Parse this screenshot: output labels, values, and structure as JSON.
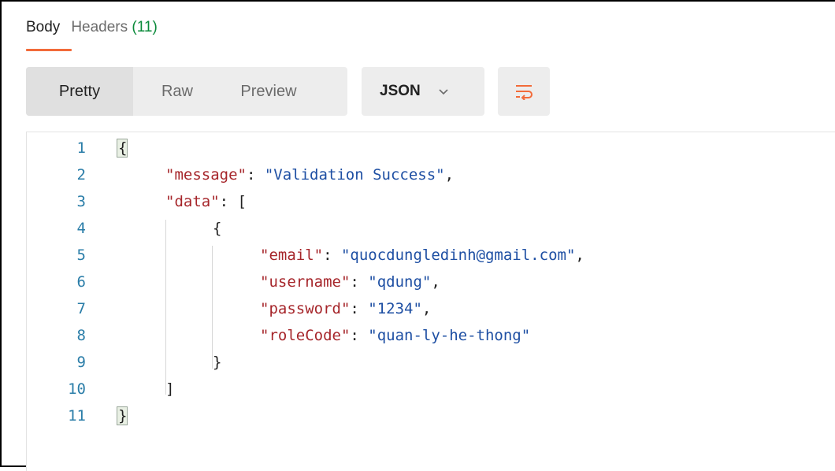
{
  "tabs": {
    "body_label": "Body",
    "headers_label": "Headers",
    "headers_count": "(11)"
  },
  "toolbar": {
    "view_modes": [
      "Pretty",
      "Raw",
      "Preview"
    ],
    "selected_view": "Pretty",
    "format_label": "JSON",
    "wrap_icon": "wrap-lines-icon"
  },
  "colors": {
    "accent": "#f26b3a",
    "line_number": "#2a7da8",
    "json_key": "#a6262b",
    "json_string": "#1e4fa3",
    "headers_count": "#0a8a3a"
  },
  "editor": {
    "lines": [
      {
        "n": "1",
        "indent": 0,
        "parts": [
          {
            "t": "{",
            "c": "p"
          }
        ]
      },
      {
        "n": "2",
        "indent": 1,
        "parts": [
          {
            "t": "\"message\"",
            "c": "k"
          },
          {
            "t": ": ",
            "c": "p"
          },
          {
            "t": "\"Validation Success\"",
            "c": "s"
          },
          {
            "t": ",",
            "c": "p"
          }
        ]
      },
      {
        "n": "3",
        "indent": 1,
        "parts": [
          {
            "t": "\"data\"",
            "c": "k"
          },
          {
            "t": ": [",
            "c": "p"
          }
        ]
      },
      {
        "n": "4",
        "indent": 2,
        "parts": [
          {
            "t": "{",
            "c": "p"
          }
        ]
      },
      {
        "n": "5",
        "indent": 3,
        "parts": [
          {
            "t": "\"email\"",
            "c": "k"
          },
          {
            "t": ": ",
            "c": "p"
          },
          {
            "t": "\"quocdungledinh@gmail.com\"",
            "c": "s"
          },
          {
            "t": ",",
            "c": "p"
          }
        ]
      },
      {
        "n": "6",
        "indent": 3,
        "parts": [
          {
            "t": "\"username\"",
            "c": "k"
          },
          {
            "t": ": ",
            "c": "p"
          },
          {
            "t": "\"qdung\"",
            "c": "s"
          },
          {
            "t": ",",
            "c": "p"
          }
        ]
      },
      {
        "n": "7",
        "indent": 3,
        "parts": [
          {
            "t": "\"password\"",
            "c": "k"
          },
          {
            "t": ": ",
            "c": "p"
          },
          {
            "t": "\"1234\"",
            "c": "s"
          },
          {
            "t": ",",
            "c": "p"
          }
        ]
      },
      {
        "n": "8",
        "indent": 3,
        "parts": [
          {
            "t": "\"roleCode\"",
            "c": "k"
          },
          {
            "t": ": ",
            "c": "p"
          },
          {
            "t": "\"quan-ly-he-thong\"",
            "c": "s"
          }
        ]
      },
      {
        "n": "9",
        "indent": 2,
        "parts": [
          {
            "t": "}",
            "c": "p"
          }
        ]
      },
      {
        "n": "10",
        "indent": 1,
        "parts": [
          {
            "t": "]",
            "c": "p"
          }
        ]
      },
      {
        "n": "11",
        "indent": 0,
        "parts": [
          {
            "t": "}",
            "c": "p"
          }
        ]
      }
    ]
  }
}
